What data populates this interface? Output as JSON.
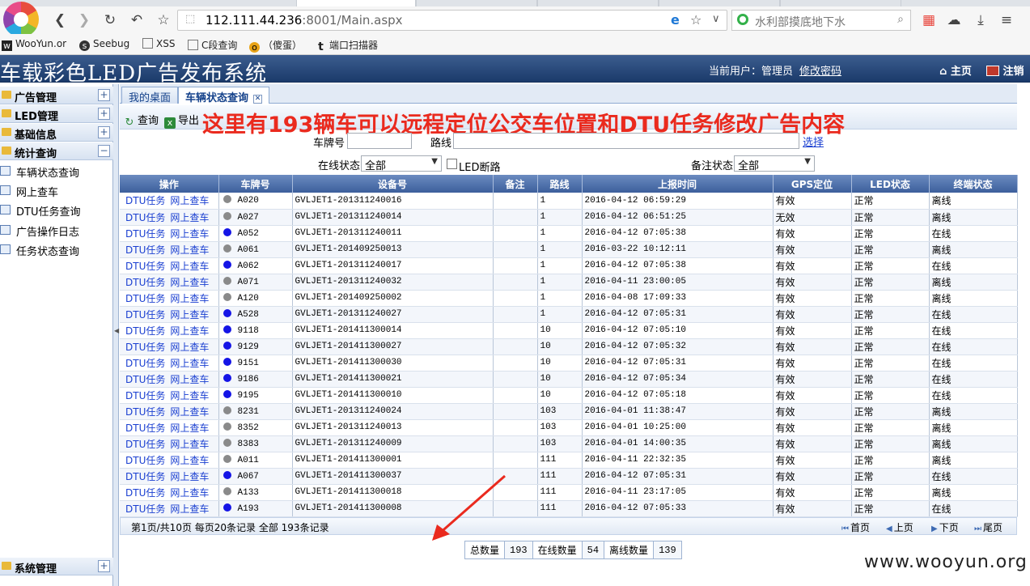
{
  "browser": {
    "url_host": "112.111.44.236",
    "url_rest": ":8001/Main.aspx",
    "search_placeholder": "水利部摸底地下水",
    "bookmarks": [
      "WooYun.or",
      "Seebug",
      "XSS",
      "C段查询",
      "（傻蛋）",
      "端口扫描器"
    ]
  },
  "app": {
    "title": "车载彩色LED广告发布系统",
    "current_user_label": "当前用户：管理员",
    "change_password": "修改密码",
    "home": "主页",
    "logout": "注销"
  },
  "sidebar": {
    "groups": [
      {
        "label": "广告管理",
        "toggle": "+"
      },
      {
        "label": "LED管理",
        "toggle": "+"
      },
      {
        "label": "基础信息",
        "toggle": "+"
      },
      {
        "label": "统计查询",
        "toggle": "−"
      }
    ],
    "items": [
      "车辆状态查询",
      "网上查车",
      "DTU任务查询",
      "广告操作日志",
      "任务状态查询"
    ],
    "bottom_group": {
      "label": "系统管理",
      "toggle": "+"
    }
  },
  "tabs": [
    {
      "label": "我的桌面"
    },
    {
      "label": "车辆状态查询"
    }
  ],
  "toolbar": {
    "query": "查询",
    "export": "导出"
  },
  "annotation": "这里有193辆车可以远程定位公交车位置和DTU任务修改广告内容",
  "filters": {
    "plate_label": "车牌号",
    "route_label": "路线",
    "choose": "选择",
    "online_label": "在线状态",
    "online_value": "全部",
    "led_fault": "LED断路",
    "remark_label": "备注状态",
    "remark_value": "全部"
  },
  "table": {
    "columns": [
      "操作",
      "车牌号",
      "设备号",
      "备注",
      "路线",
      "上报时间",
      "GPS定位",
      "LED状态",
      "终端状态"
    ],
    "action1": "DTU任务",
    "action2": "网上查车",
    "status_colors": {
      "online": "#1414e6",
      "offline": "#8a8a8a"
    },
    "rows": [
      {
        "plate": "A020",
        "device": "GVLJET1-201311240016",
        "remark": "",
        "route": "1",
        "time": "2016-04-12 06:59:29",
        "gps": "有效",
        "led": "正常",
        "term": "离线"
      },
      {
        "plate": "A027",
        "device": "GVLJET1-201311240014",
        "remark": "",
        "route": "1",
        "time": "2016-04-12 06:51:25",
        "gps": "无效",
        "led": "正常",
        "term": "离线"
      },
      {
        "plate": "A052",
        "device": "GVLJET1-201311240011",
        "remark": "",
        "route": "1",
        "time": "2016-04-12 07:05:38",
        "gps": "有效",
        "led": "正常",
        "term": "在线"
      },
      {
        "plate": "A061",
        "device": "GVLJET1-201409250013",
        "remark": "",
        "route": "1",
        "time": "2016-03-22 10:12:11",
        "gps": "有效",
        "led": "正常",
        "term": "离线"
      },
      {
        "plate": "A062",
        "device": "GVLJET1-201311240017",
        "remark": "",
        "route": "1",
        "time": "2016-04-12 07:05:38",
        "gps": "有效",
        "led": "正常",
        "term": "在线"
      },
      {
        "plate": "A071",
        "device": "GVLJET1-201311240032",
        "remark": "",
        "route": "1",
        "time": "2016-04-11 23:00:05",
        "gps": "有效",
        "led": "正常",
        "term": "离线"
      },
      {
        "plate": "A120",
        "device": "GVLJET1-201409250002",
        "remark": "",
        "route": "1",
        "time": "2016-04-08 17:09:33",
        "gps": "有效",
        "led": "正常",
        "term": "离线"
      },
      {
        "plate": "A528",
        "device": "GVLJET1-201311240027",
        "remark": "",
        "route": "1",
        "time": "2016-04-12 07:05:31",
        "gps": "有效",
        "led": "正常",
        "term": "在线"
      },
      {
        "plate": "9118",
        "device": "GVLJET1-201411300014",
        "remark": "",
        "route": "10",
        "time": "2016-04-12 07:05:10",
        "gps": "有效",
        "led": "正常",
        "term": "在线"
      },
      {
        "plate": "9129",
        "device": "GVLJET1-201411300027",
        "remark": "",
        "route": "10",
        "time": "2016-04-12 07:05:32",
        "gps": "有效",
        "led": "正常",
        "term": "在线"
      },
      {
        "plate": "9151",
        "device": "GVLJET1-201411300030",
        "remark": "",
        "route": "10",
        "time": "2016-04-12 07:05:31",
        "gps": "有效",
        "led": "正常",
        "term": "在线"
      },
      {
        "plate": "9186",
        "device": "GVLJET1-201411300021",
        "remark": "",
        "route": "10",
        "time": "2016-04-12 07:05:34",
        "gps": "有效",
        "led": "正常",
        "term": "在线"
      },
      {
        "plate": "9195",
        "device": "GVLJET1-201411300010",
        "remark": "",
        "route": "10",
        "time": "2016-04-12 07:05:18",
        "gps": "有效",
        "led": "正常",
        "term": "在线"
      },
      {
        "plate": "8231",
        "device": "GVLJET1-201311240024",
        "remark": "",
        "route": "103",
        "time": "2016-04-01 11:38:47",
        "gps": "有效",
        "led": "正常",
        "term": "离线"
      },
      {
        "plate": "8352",
        "device": "GVLJET1-201311240013",
        "remark": "",
        "route": "103",
        "time": "2016-04-01 10:25:00",
        "gps": "有效",
        "led": "正常",
        "term": "离线"
      },
      {
        "plate": "8383",
        "device": "GVLJET1-201311240009",
        "remark": "",
        "route": "103",
        "time": "2016-04-01 14:00:35",
        "gps": "有效",
        "led": "正常",
        "term": "离线"
      },
      {
        "plate": "A011",
        "device": "GVLJET1-201411300001",
        "remark": "",
        "route": "111",
        "time": "2016-04-11 22:32:35",
        "gps": "有效",
        "led": "正常",
        "term": "离线"
      },
      {
        "plate": "A067",
        "device": "GVLJET1-201411300037",
        "remark": "",
        "route": "111",
        "time": "2016-04-12 07:05:31",
        "gps": "有效",
        "led": "正常",
        "term": "在线"
      },
      {
        "plate": "A133",
        "device": "GVLJET1-201411300018",
        "remark": "",
        "route": "111",
        "time": "2016-04-11 23:17:05",
        "gps": "有效",
        "led": "正常",
        "term": "离线"
      },
      {
        "plate": "A193",
        "device": "GVLJET1-201411300008",
        "remark": "",
        "route": "111",
        "time": "2016-04-12 07:05:33",
        "gps": "有效",
        "led": "正常",
        "term": "在线"
      }
    ]
  },
  "pager": {
    "info": "第1页/共10页 每页20条记录 全部 193条记录",
    "first": "首页",
    "prev": "上页",
    "next": "下页",
    "last": "尾页"
  },
  "summary": {
    "total_label": "总数量",
    "total": "193",
    "online_label": "在线数量",
    "online": "54",
    "offline_label": "离线数量",
    "offline": "139"
  },
  "watermark": "www.wooyun.org",
  "colors": {
    "accent": "#1b3a6a",
    "annotation": "#ea2a1e",
    "link": "#1a3fd1"
  }
}
